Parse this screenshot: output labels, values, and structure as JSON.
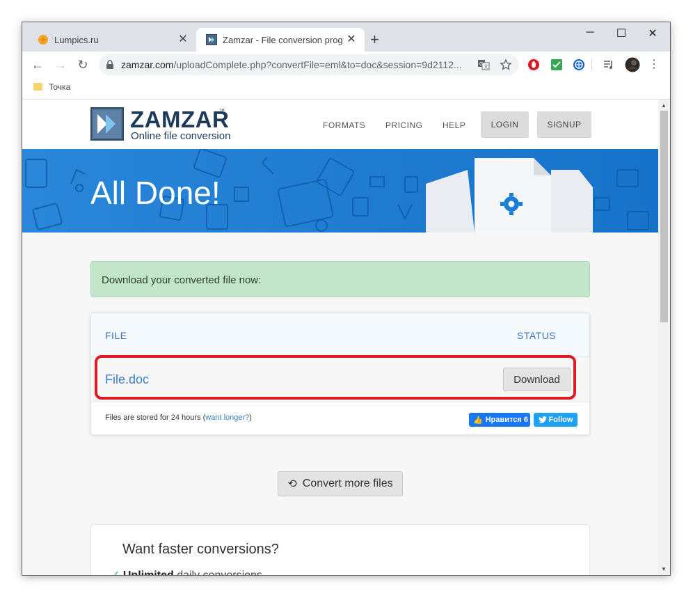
{
  "browser": {
    "tabs": [
      {
        "title": "Lumpics.ru",
        "active": false,
        "favicon": "orange-circle"
      },
      {
        "title": "Zamzar - File conversion progres",
        "active": true,
        "favicon": "zamzar-logo"
      }
    ],
    "new_tab_label": "+",
    "window_controls": {
      "minimize": "─",
      "maximize": "☐",
      "close": "✕"
    },
    "url": {
      "host": "zamzar.com",
      "path": "/uploadComplete.php?convertFile=eml&to=doc&session=9d2112..."
    },
    "bookmarks": [
      {
        "label": "Точка",
        "icon": "folder-icon"
      }
    ]
  },
  "site": {
    "logo_name": "ZAMZAR",
    "logo_tm": "™",
    "logo_tagline": "Online file conversion",
    "nav": {
      "formats": "FORMATS",
      "pricing": "PRICING",
      "help": "HELP",
      "login": "LOGIN",
      "signup": "SIGNUP"
    },
    "hero_title": "All Done!",
    "success_message": "Download your converted file now:",
    "table": {
      "col_file": "FILE",
      "col_status": "STATUS",
      "rows": [
        {
          "file": "File.doc",
          "action": "Download"
        }
      ],
      "storage_note": "Files are stored for 24 hours (",
      "storage_link": "want longer?",
      "storage_note_end": ")",
      "facebook_label": "Нравится 6",
      "twitter_label": "Follow"
    },
    "convert_more": "Convert more files",
    "promo": {
      "title": "Want faster conversions?",
      "item_bold": "Unlimited",
      "item_rest": " daily conversions"
    }
  },
  "colors": {
    "accent_blue": "#1a7ed6",
    "success_bg": "#c3e6cb",
    "highlight_red": "#e01a22",
    "link_blue": "#3a7fc7"
  }
}
